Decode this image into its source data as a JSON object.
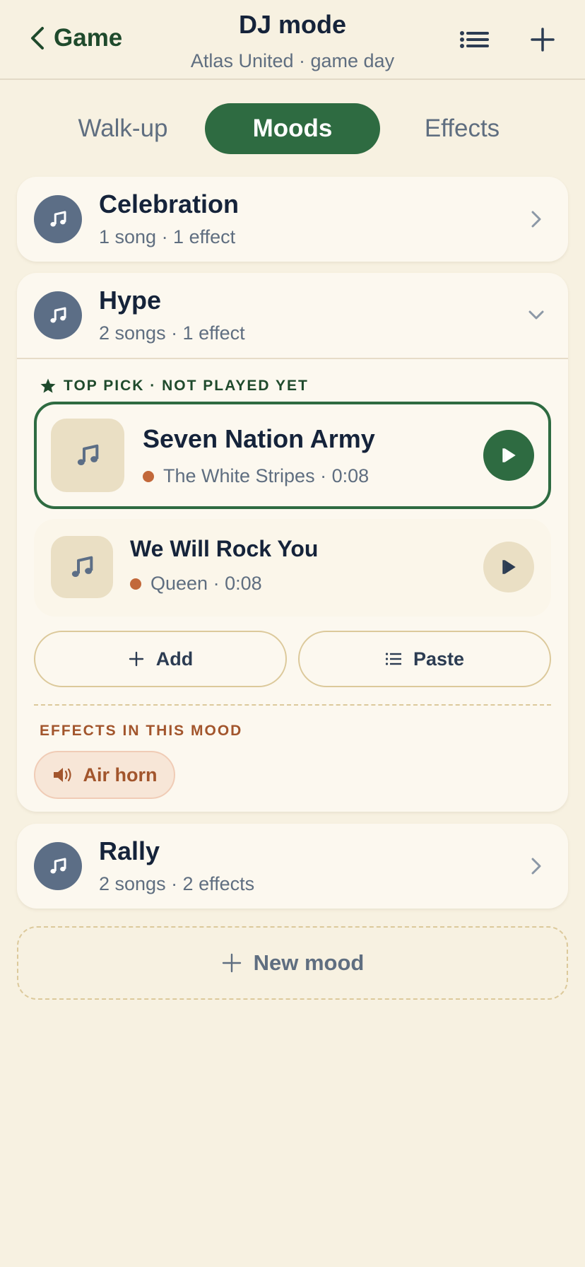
{
  "header": {
    "back_label": "Game",
    "title": "DJ mode",
    "subtitle": "Atlas United · game day",
    "list_icon": "list-icon",
    "add_icon": "plus-icon"
  },
  "tabs": [
    {
      "label": "Walk-up",
      "active": false
    },
    {
      "label": "Moods",
      "active": true
    },
    {
      "label": "Effects",
      "active": false
    }
  ],
  "moods": [
    {
      "name": "Celebration",
      "meta": "1 song · 1 effect",
      "expanded": false
    },
    {
      "name": "Hype",
      "meta": "2 songs · 1 effect",
      "expanded": true,
      "top_pick_label": "TOP PICK · NOT PLAYED YET",
      "songs": [
        {
          "title": "Seven Nation Army",
          "artist": "The White Stripes",
          "duration": "0:08",
          "top_pick": true
        },
        {
          "title": "We Will Rock You",
          "artist": "Queen",
          "duration": "0:08",
          "top_pick": false
        }
      ],
      "add_label": "Add",
      "paste_label": "Paste",
      "effects_label": "EFFECTS IN THIS MOOD",
      "effects": [
        {
          "name": "Air horn",
          "icon": "speaker-icon"
        }
      ]
    },
    {
      "name": "Rally",
      "meta": "2 songs · 2 effects",
      "expanded": false
    }
  ],
  "new_mood_label": "New mood",
  "colors": {
    "background": "#f7f1e1",
    "accent_green": "#2e6b41",
    "avatar_slate": "#5c6e86",
    "effect_orange": "#a2552c",
    "artist_dot": "#c2683a"
  }
}
